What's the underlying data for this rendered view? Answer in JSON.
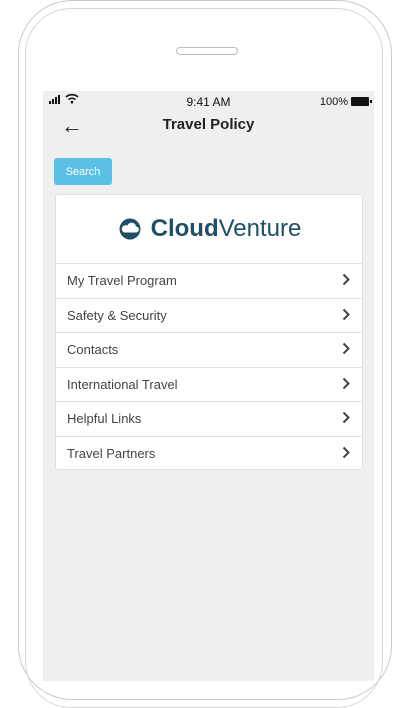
{
  "status_bar": {
    "time": "9:41 AM",
    "battery": "100%"
  },
  "nav": {
    "back": "←",
    "title": "Travel Policy"
  },
  "search": {
    "label": "Search"
  },
  "brand": {
    "part1": "Cloud",
    "part2": "Venture",
    "accent": "#1f4f66"
  },
  "menu": [
    {
      "label": "My Travel Program"
    },
    {
      "label": "Safety & Security"
    },
    {
      "label": "Contacts"
    },
    {
      "label": "International Travel"
    },
    {
      "label": "Helpful Links"
    },
    {
      "label": "Travel Partners"
    }
  ],
  "colors": {
    "button": "#5bc0e3",
    "screen_bg": "#efefef"
  }
}
